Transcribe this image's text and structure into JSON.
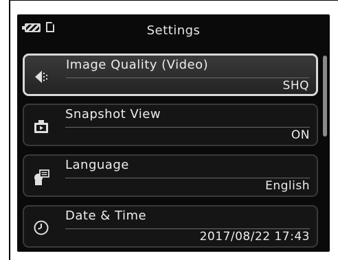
{
  "header": {
    "title": "Settings",
    "battery_icon": "battery-icon",
    "card_icon": "memory-card-icon"
  },
  "menu": {
    "items": [
      {
        "label": "Image Quality (Video)",
        "value": "SHQ",
        "icon": "image-quality-icon",
        "selected": true
      },
      {
        "label": "Snapshot View",
        "value": "ON",
        "icon": "snapshot-icon",
        "selected": false
      },
      {
        "label": "Language",
        "value": "English",
        "icon": "language-icon",
        "selected": false
      },
      {
        "label": "Date & Time",
        "value": "2017/08/22 17:43",
        "icon": "clock-icon",
        "selected": false
      }
    ]
  },
  "colors": {
    "screen_bg": "#0a0a0a",
    "text": "#ededed",
    "selected_border": "#d9d9d9"
  }
}
